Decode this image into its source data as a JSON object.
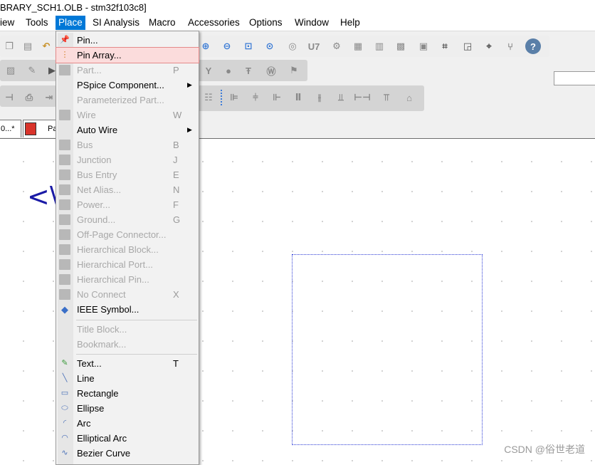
{
  "window": {
    "title": "BRARY_SCH1.OLB - stm32f103c8]"
  },
  "menubar": {
    "items": [
      "iew",
      "Tools",
      "Place",
      "SI Analysis",
      "Macro",
      "Accessories",
      "Options",
      "Window",
      "Help"
    ],
    "active": "Place"
  },
  "tabs": [
    {
      "label": "0...*"
    },
    {
      "label": "Pa"
    }
  ],
  "canvas": {
    "part_text": "<\\"
  },
  "place_menu": {
    "items": [
      {
        "label": "Pin...",
        "shortcut": "",
        "enabled": true,
        "icon": "pin-icon"
      },
      {
        "label": "Pin Array...",
        "shortcut": "",
        "enabled": true,
        "highlighted": true,
        "icon": "pin-array-icon"
      },
      {
        "label": "Part...",
        "shortcut": "P",
        "enabled": false,
        "icon": "part-icon"
      },
      {
        "label": "PSpice Component...",
        "shortcut": "",
        "enabled": true,
        "submenu": true,
        "icon": ""
      },
      {
        "label": "Parameterized Part...",
        "shortcut": "",
        "enabled": false,
        "icon": ""
      },
      {
        "label": "Wire",
        "shortcut": "W",
        "enabled": false,
        "icon": "wire-icon"
      },
      {
        "label": "Auto Wire",
        "shortcut": "",
        "enabled": true,
        "submenu": true,
        "icon": ""
      },
      {
        "label": "Bus",
        "shortcut": "B",
        "enabled": false,
        "icon": "bus-icon"
      },
      {
        "label": "Junction",
        "shortcut": "J",
        "enabled": false,
        "icon": "junction-icon"
      },
      {
        "label": "Bus Entry",
        "shortcut": "E",
        "enabled": false,
        "icon": "bus-entry-icon"
      },
      {
        "label": "Net Alias...",
        "shortcut": "N",
        "enabled": false,
        "icon": "net-alias-icon"
      },
      {
        "label": "Power...",
        "shortcut": "F",
        "enabled": false,
        "icon": "power-icon"
      },
      {
        "label": "Ground...",
        "shortcut": "G",
        "enabled": false,
        "icon": "ground-icon"
      },
      {
        "label": "Off-Page Connector...",
        "shortcut": "",
        "enabled": false,
        "icon": "off-page-connector-icon"
      },
      {
        "label": "Hierarchical Block...",
        "shortcut": "",
        "enabled": false,
        "icon": "hierarchical-block-icon"
      },
      {
        "label": "Hierarchical Port...",
        "shortcut": "",
        "enabled": false,
        "icon": "hierarchical-port-icon"
      },
      {
        "label": "Hierarchical Pin...",
        "shortcut": "",
        "enabled": false,
        "icon": "hierarchical-pin-icon"
      },
      {
        "label": "No Connect",
        "shortcut": "X",
        "enabled": false,
        "icon": "no-connect-icon"
      },
      {
        "label": "IEEE Symbol...",
        "shortcut": "",
        "enabled": true,
        "icon": "ieee-symbol-icon"
      },
      {
        "separator": true
      },
      {
        "label": "Title Block...",
        "shortcut": "",
        "enabled": false,
        "icon": ""
      },
      {
        "label": "Bookmark...",
        "shortcut": "",
        "enabled": false,
        "icon": ""
      },
      {
        "separator": true
      },
      {
        "label": "Text...",
        "shortcut": "T",
        "enabled": true,
        "icon": "text-icon"
      },
      {
        "label": "Line",
        "shortcut": "",
        "enabled": true,
        "icon": "line-icon"
      },
      {
        "label": "Rectangle",
        "shortcut": "",
        "enabled": true,
        "icon": "rectangle-icon"
      },
      {
        "label": "Ellipse",
        "shortcut": "",
        "enabled": true,
        "icon": "ellipse-icon"
      },
      {
        "label": "Arc",
        "shortcut": "",
        "enabled": true,
        "icon": "arc-icon"
      },
      {
        "label": "Elliptical Arc",
        "shortcut": "",
        "enabled": true,
        "icon": "elliptical-arc-icon"
      },
      {
        "label": "Bezier Curve",
        "shortcut": "",
        "enabled": true,
        "icon": "bezier-curve-icon"
      }
    ]
  },
  "watermark": "CSDN @俗世老道",
  "colors": {
    "menu_active": "#0078d7",
    "highlight_bg": "#fbdcdc",
    "selection_box": "#2c3bd6",
    "part_text": "#1a1aa6"
  }
}
